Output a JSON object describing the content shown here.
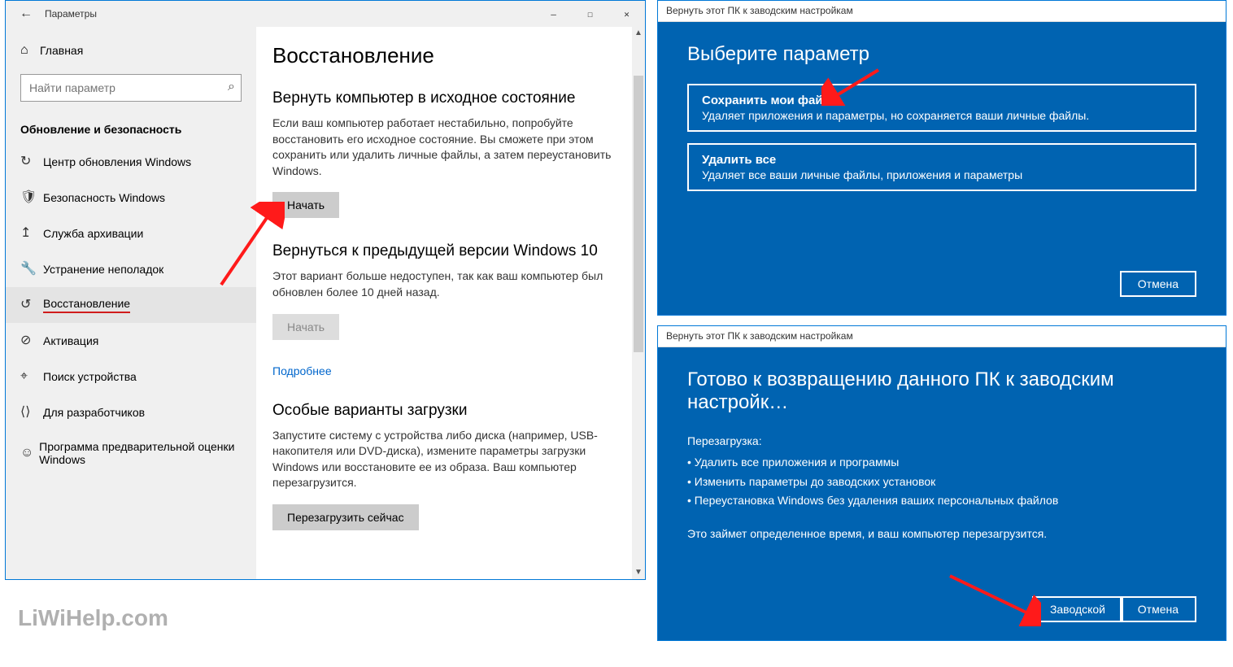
{
  "settings": {
    "windowTitle": "Параметры",
    "backGlyph": "←",
    "minGlyph": "—",
    "maxGlyph": "☐",
    "closeGlyph": "✕",
    "home": {
      "icon": "⌂",
      "label": "Главная"
    },
    "search": {
      "placeholder": "Найти параметр"
    },
    "sectionTitle": "Обновление и безопасность",
    "nav": [
      {
        "icon": "↻",
        "label": "Центр обновления Windows"
      },
      {
        "icon": "🛡",
        "label": "Безопасность Windows"
      },
      {
        "icon": "↥",
        "label": "Служба архивации"
      },
      {
        "icon": "🔧",
        "label": "Устранение неполадок"
      },
      {
        "icon": "↺",
        "label": "Восстановление",
        "active": true
      },
      {
        "icon": "⊘",
        "label": "Активация"
      },
      {
        "icon": "⌖",
        "label": "Поиск устройства"
      },
      {
        "icon": "⟨⟩",
        "label": "Для разработчиков"
      },
      {
        "icon": "☺",
        "label": "Программа предварительной оценки Windows"
      }
    ],
    "content": {
      "h1": "Восстановление",
      "reset": {
        "h2": "Вернуть компьютер в исходное состояние",
        "p": "Если ваш компьютер работает нестабильно, попробуйте восстановить его исходное состояние. Вы сможете при этом сохранить или удалить личные файлы, а затем переустановить Windows.",
        "btn": "Начать"
      },
      "goback": {
        "h2": "Вернуться к предыдущей версии Windows 10",
        "p": "Этот вариант больше недоступен, так как ваш компьютер был обновлен более 10 дней назад.",
        "btn": "Начать",
        "link": "Подробнее"
      },
      "advanced": {
        "h2": "Особые варианты загрузки",
        "p": "Запустите систему с устройства либо диска (например, USB-накопителя или DVD-диска), измените параметры загрузки Windows или восстановите ее из образа. Ваш компьютер перезагрузится.",
        "btn": "Перезагрузить сейчас"
      }
    }
  },
  "dialogTop": {
    "title": "Вернуть этот ПК к заводским настройкам",
    "heading": "Выберите параметр",
    "opt1": {
      "title": "Сохранить мои файлы",
      "desc": "Удаляет приложения и параметры, но сохраняется ваши личные файлы."
    },
    "opt2": {
      "title": "Удалить все",
      "desc": "Удаляет все ваши личные файлы, приложения и параметры"
    },
    "cancel": "Отмена"
  },
  "dialogBottom": {
    "title": "Вернуть этот ПК к заводским настройкам",
    "heading": "Готово к возвращению данного ПК к заводским настройк…",
    "listHeader": "Перезагрузка:",
    "items": [
      "Удалить все приложения и программы",
      "Изменить параметры до заводских установок",
      "Переустановка Windows без удаления ваших персональных файлов"
    ],
    "footer": "Это займет определенное время, и ваш компьютер перезагрузится.",
    "factory": "Заводской",
    "cancel": "Отмена"
  },
  "watermark": "LiWiHelp.com",
  "colors": {
    "blue": "#0063b1",
    "outline": "#0078d7",
    "red": "#d01c1c"
  }
}
